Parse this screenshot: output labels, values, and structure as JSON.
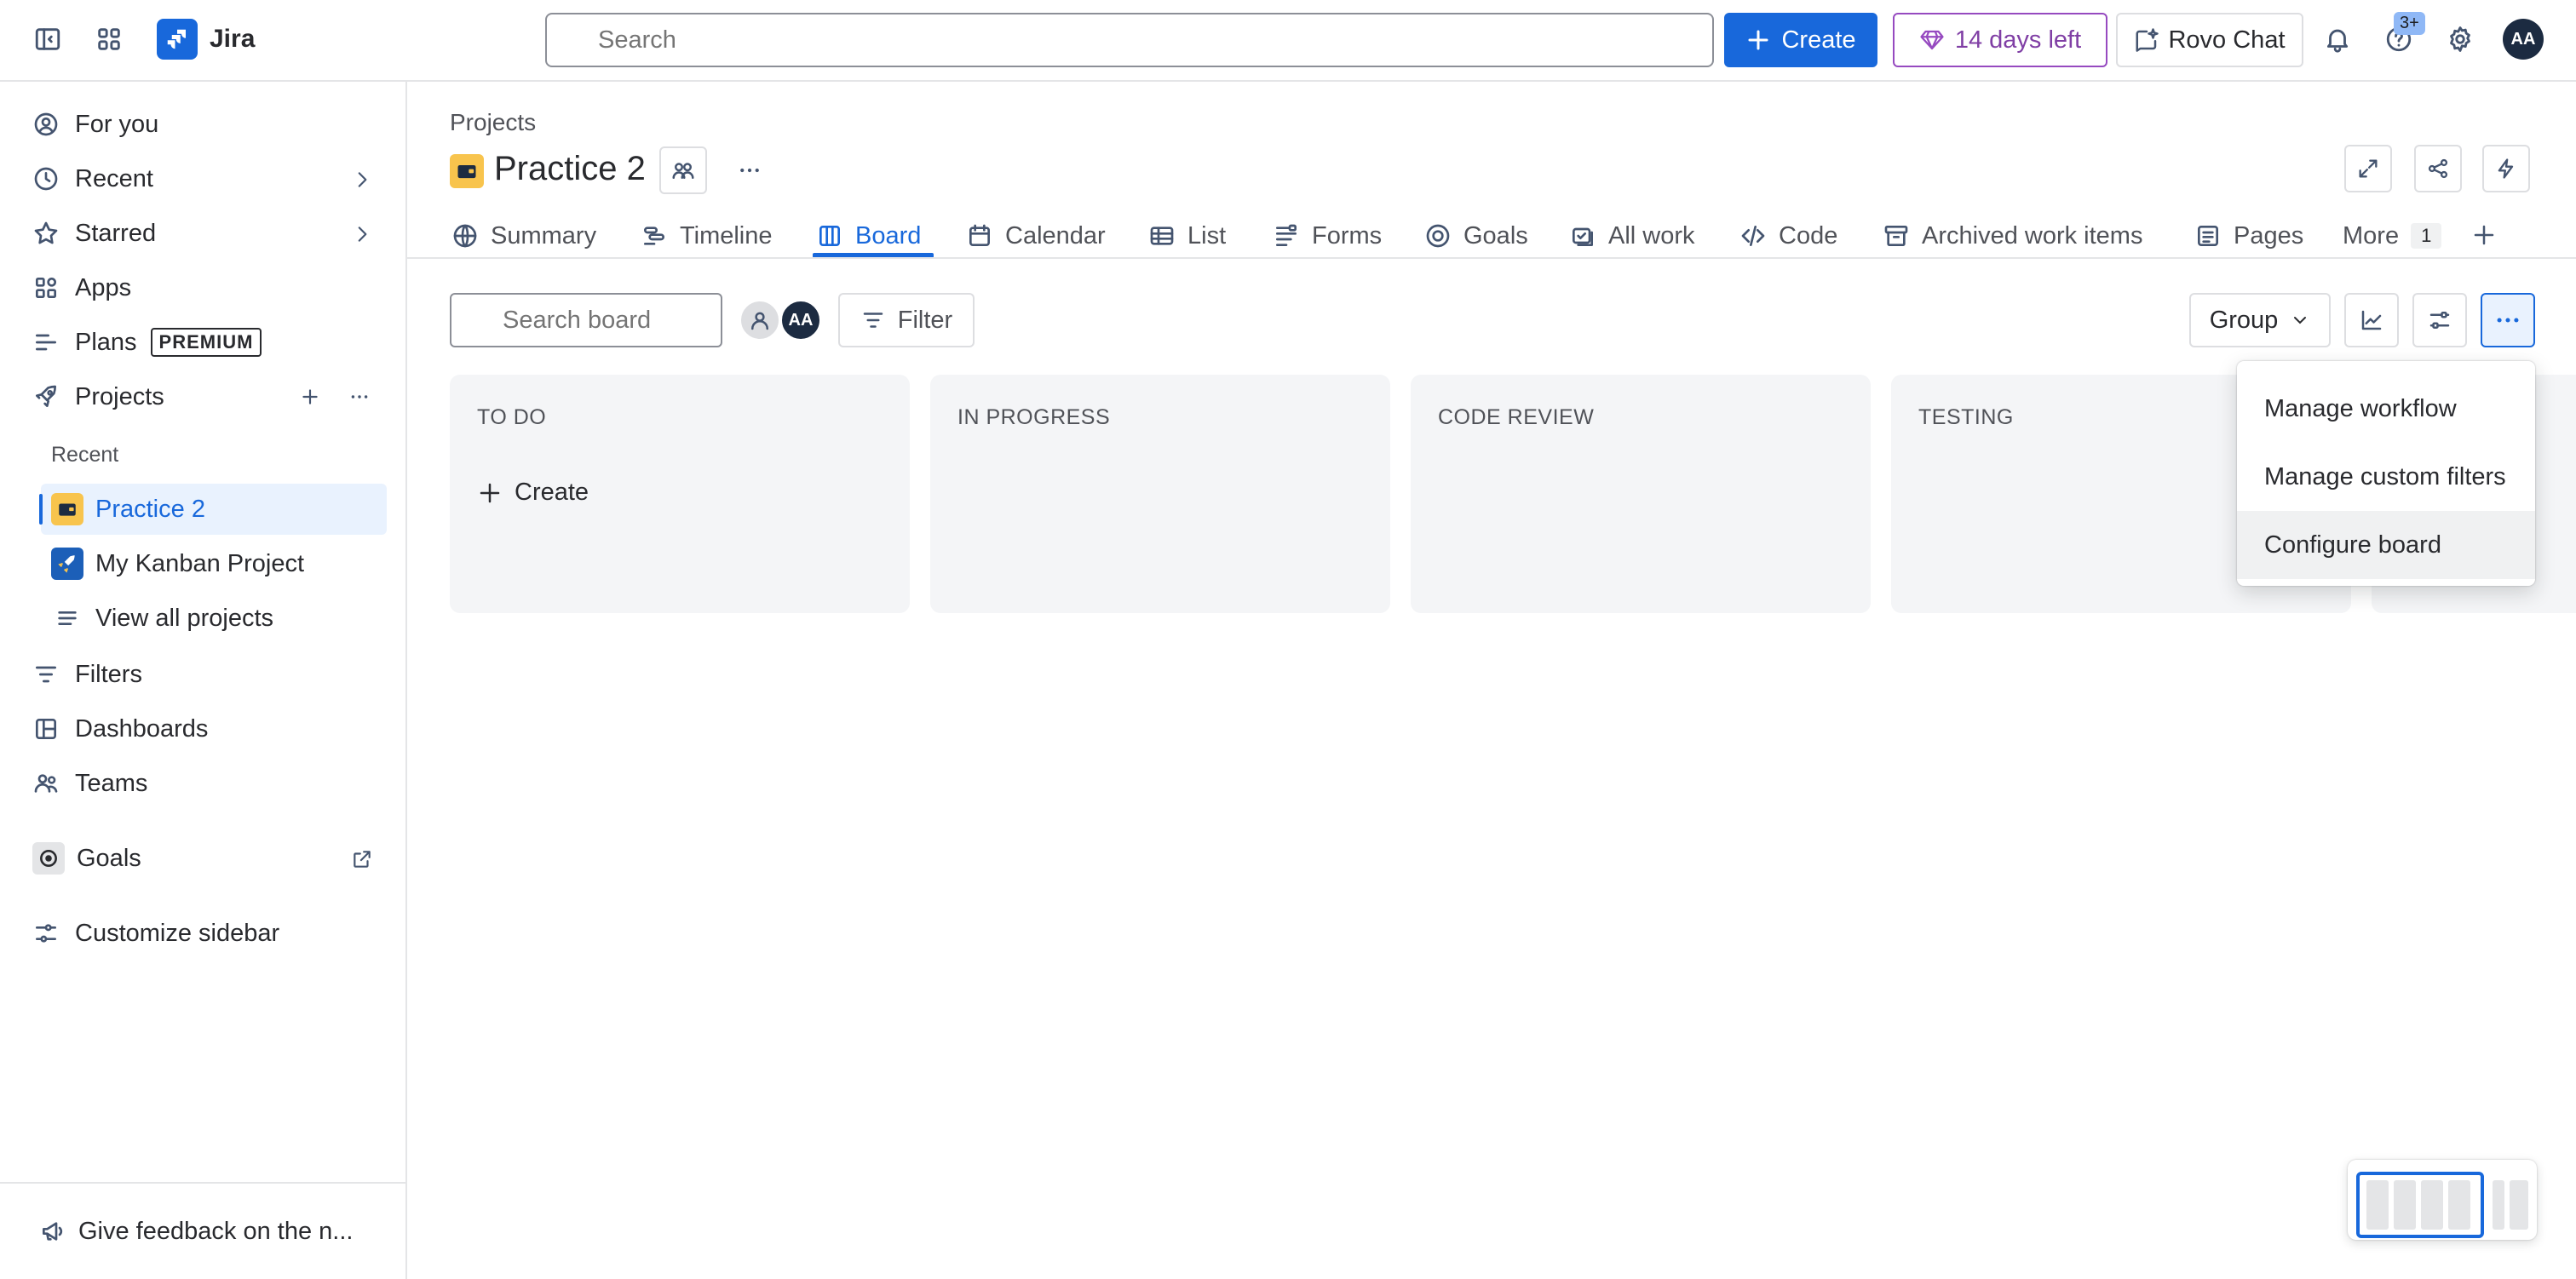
{
  "topbar": {
    "app_name": "Jira",
    "search_placeholder": "Search",
    "create_label": "Create",
    "trial_label": "14 days left",
    "rovo_label": "Rovo Chat",
    "help_badge": "3+",
    "avatar_initials": "AA"
  },
  "sidebar": {
    "items": [
      {
        "label": "For you",
        "icon": "user-circle-icon"
      },
      {
        "label": "Recent",
        "icon": "clock-icon"
      },
      {
        "label": "Starred",
        "icon": "star-icon"
      },
      {
        "label": "Apps",
        "icon": "apps-icon"
      },
      {
        "label": "Plans",
        "icon": "plans-icon",
        "badge": "PREMIUM"
      },
      {
        "label": "Projects",
        "icon": "rocket-icon"
      }
    ],
    "recent_heading": "Recent",
    "projects": [
      {
        "label": "Practice 2",
        "active": true
      },
      {
        "label": "My Kanban Project"
      },
      {
        "label": "View all projects"
      }
    ],
    "bottom_items": [
      {
        "label": "Filters"
      },
      {
        "label": "Dashboards"
      },
      {
        "label": "Teams"
      },
      {
        "label": "Goals"
      },
      {
        "label": "Customize sidebar"
      }
    ],
    "feedback_label": "Give feedback on the n..."
  },
  "header": {
    "breadcrumb": "Projects",
    "project_title": "Practice 2"
  },
  "tabs": [
    {
      "label": "Summary"
    },
    {
      "label": "Timeline"
    },
    {
      "label": "Board",
      "selected": true
    },
    {
      "label": "Calendar"
    },
    {
      "label": "List"
    },
    {
      "label": "Forms"
    },
    {
      "label": "Goals"
    },
    {
      "label": "All work"
    },
    {
      "label": "Code"
    },
    {
      "label": "Archived work items"
    },
    {
      "label": "Pages"
    },
    {
      "label": "More",
      "count": "1"
    }
  ],
  "toolbar": {
    "search_placeholder": "Search board",
    "avatar_initials": "AA",
    "filter_label": "Filter",
    "group_label": "Group"
  },
  "columns": [
    {
      "title": "TO DO",
      "create_label": "Create"
    },
    {
      "title": "IN PROGRESS"
    },
    {
      "title": "CODE REVIEW"
    },
    {
      "title": "TESTING"
    }
  ],
  "dropdown": {
    "items": [
      "Manage workflow",
      "Manage custom filters",
      "Configure board"
    ],
    "highlighted": "Configure board"
  },
  "colors": {
    "accent": "#1868db",
    "trial": "#964ac0",
    "active_bg": "#e9f2fe"
  }
}
